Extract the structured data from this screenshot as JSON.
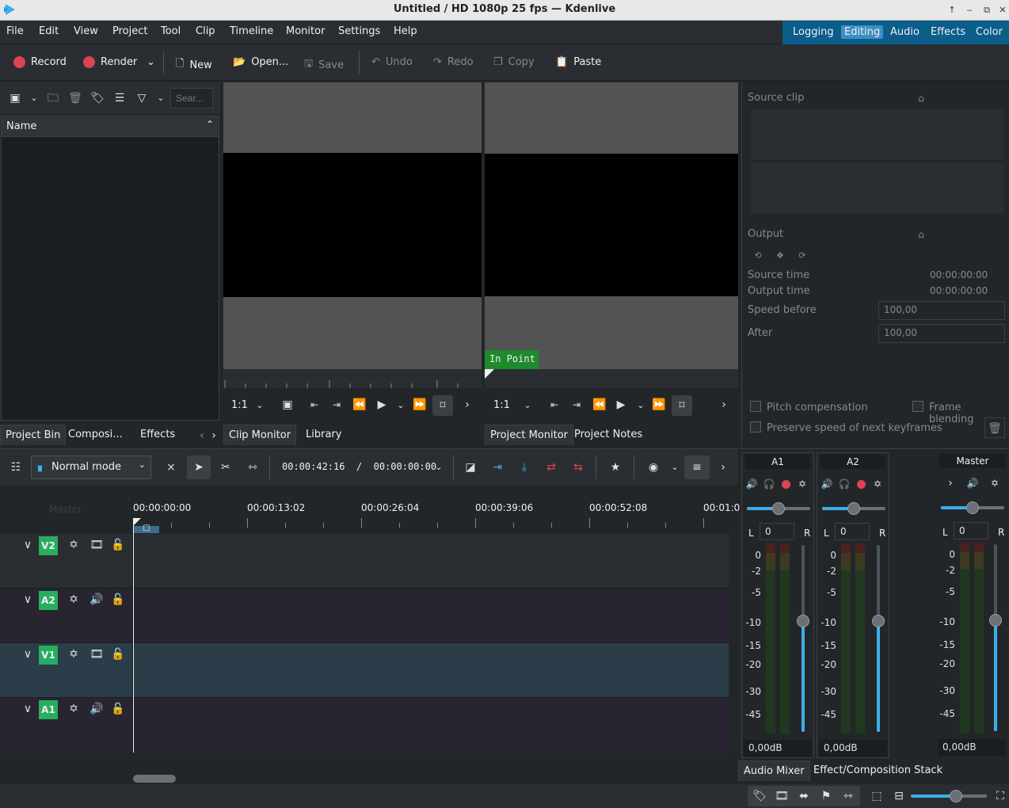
{
  "window": {
    "title": "Untitled / HD 1080p 25 fps — Kdenlive"
  },
  "menu": [
    "File",
    "Edit",
    "View",
    "Project",
    "Tool",
    "Clip",
    "Timeline",
    "Monitor",
    "Settings",
    "Help"
  ],
  "layouts": {
    "items": [
      "Logging",
      "Editing",
      "Audio",
      "Effects",
      "Color"
    ],
    "active": "Editing"
  },
  "toolbar": {
    "record": "Record",
    "render": "Render",
    "new": "New",
    "open": "Open...",
    "save": "Save",
    "undo": "Undo",
    "redo": "Redo",
    "copy": "Copy",
    "paste": "Paste"
  },
  "bin": {
    "search_placeholder": "Sear...",
    "column_name": "Name"
  },
  "left_tabs": [
    "Project Bin",
    "Composi...",
    "Effects"
  ],
  "clip_monitor": {
    "zoom": "1:1",
    "tabs": [
      "Clip Monitor",
      "Library"
    ]
  },
  "project_monitor": {
    "zoom": "1:1",
    "in_point": "In Point",
    "tabs": [
      "Project Monitor",
      "Project Notes"
    ]
  },
  "speed_panel": {
    "source_clip": "Source clip",
    "output": "Output",
    "source_time_label": "Source time",
    "source_time": "00:00:00:00",
    "output_time_label": "Output time",
    "output_time": "00:00:00:00",
    "speed_before_label": "Speed before",
    "speed_before": "100,00",
    "after_label": "After",
    "after": "100,00",
    "pitch": "Pitch compensation",
    "frame_blending": "Frame blending",
    "preserve": "Preserve speed of next keyframes"
  },
  "timeline": {
    "mode": "Normal mode",
    "timecode": "00:00:42:16  /  00:00:00:00",
    "master_label": "Master",
    "ruler": [
      "00:00:00:00",
      "00:00:13:02",
      "00:00:26:04",
      "00:00:39:06",
      "00:00:52:08",
      "00:01:0"
    ],
    "tracks": [
      {
        "name": "V2",
        "type": "video"
      },
      {
        "name": "A2",
        "type": "audio"
      },
      {
        "name": "V1",
        "type": "video"
      },
      {
        "name": "A1",
        "type": "audio"
      }
    ]
  },
  "mixer": {
    "channels": [
      {
        "name": "A1",
        "balance": "0",
        "db": "0,00dB"
      },
      {
        "name": "A2",
        "balance": "0",
        "db": "0,00dB"
      },
      {
        "name": "Master",
        "balance": "0",
        "db": "0,00dB"
      }
    ],
    "scale": [
      "0",
      "-2",
      "-5",
      "-10",
      "-15",
      "-20",
      "-30",
      "-45"
    ],
    "left": "L",
    "right": "R"
  },
  "bottom_tabs": [
    "Audio Mixer",
    "Effect/Composition Stack"
  ],
  "colors": {
    "accent": "#3daee9",
    "record": "#da4453",
    "in_point": "#1e8a2e",
    "track_selected": "#2a3d48"
  }
}
